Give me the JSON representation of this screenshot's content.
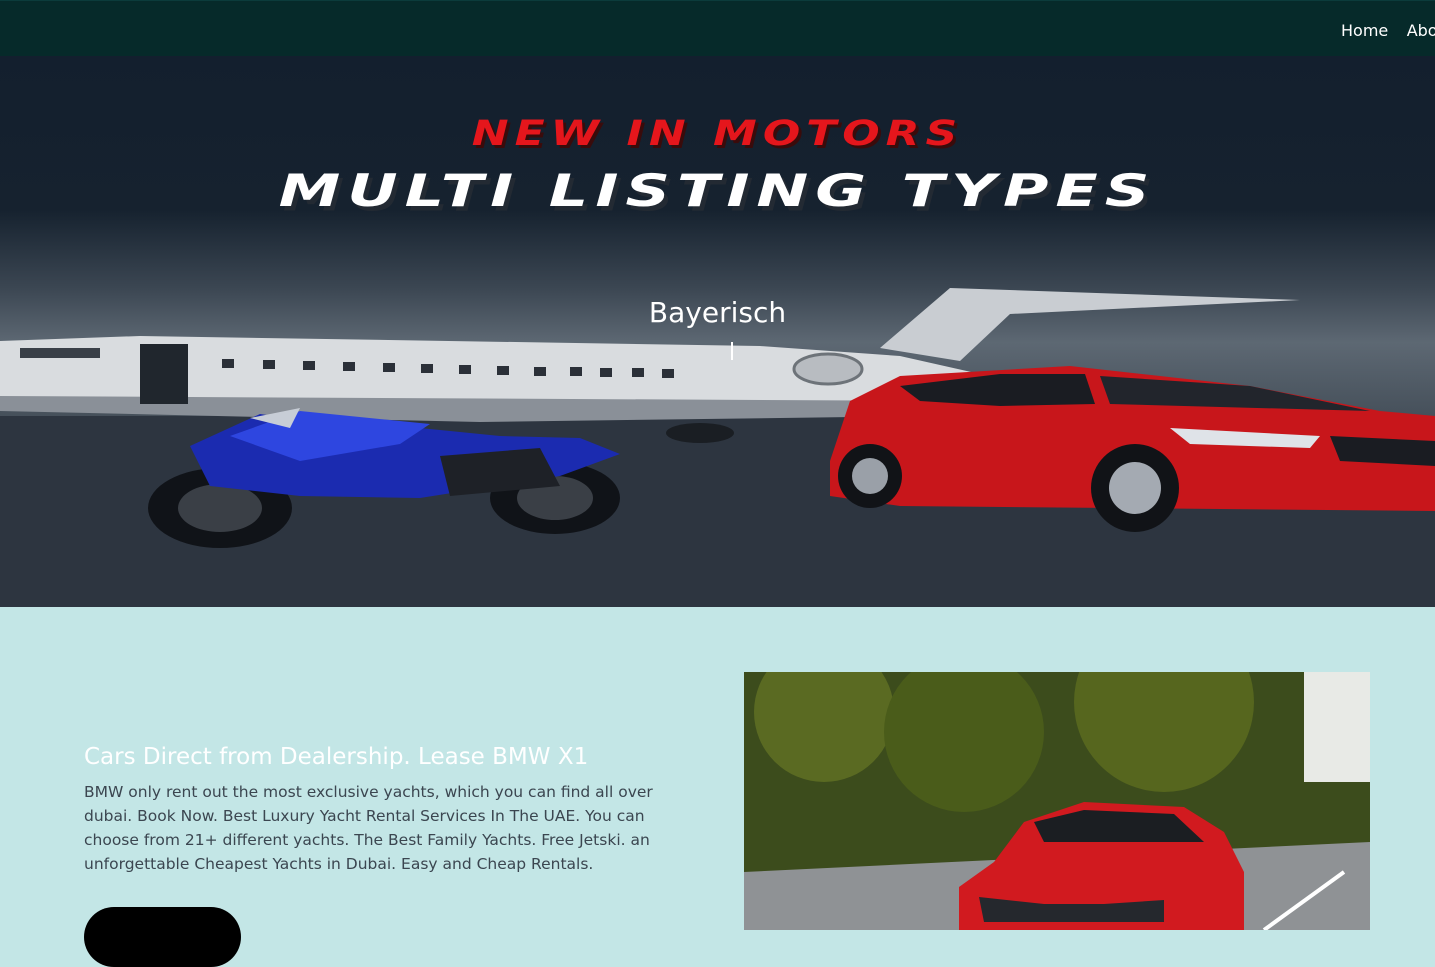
{
  "nav": {
    "items": [
      {
        "label": "Home"
      },
      {
        "label": "About"
      }
    ]
  },
  "hero": {
    "title_line1": "NEW IN MOTORS",
    "title_line2": "MULTI LISTING TYPES",
    "typed_text": "Bayerisch"
  },
  "content": {
    "heading": "Cars Direct from Dealership. Lease BMW X1",
    "body": "BMW only rent out the most exclusive yachts, which you can find all over dubai. Book Now. Best Luxury Yacht Rental Services In The UAE. You can choose from 21+ different yachts. The Best Family Yachts. Free Jetski. an unforgettable Cheapest Yachts in Dubai. Easy and Cheap Rentals.",
    "cta_label": ""
  },
  "colors": {
    "navbar": "#062a2a",
    "hero_title_red": "#e5161c",
    "section_bg": "#c3e6e6",
    "cta_bg": "#000000"
  }
}
